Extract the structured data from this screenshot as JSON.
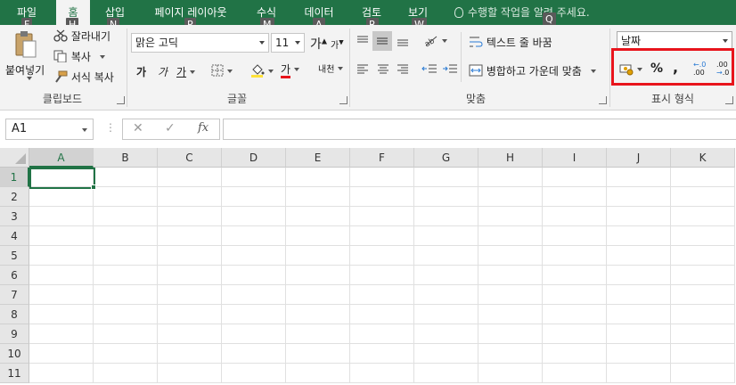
{
  "menu": {
    "tabs": [
      {
        "label": "파일",
        "key": "F"
      },
      {
        "label": "홈",
        "key": "H"
      },
      {
        "label": "삽입",
        "key": "N"
      },
      {
        "label": "페이지 레이아웃",
        "key": "P"
      },
      {
        "label": "수식",
        "key": "M"
      },
      {
        "label": "데이터",
        "key": "A"
      },
      {
        "label": "검토",
        "key": "R"
      },
      {
        "label": "보기",
        "key": "W"
      }
    ],
    "tellme": "수행할 작업을 알려 주세요.",
    "tellme_key": "Q"
  },
  "ribbon": {
    "clipboard": {
      "label": "클립보드",
      "paste": "붙여넣기",
      "cut": "잘라내기",
      "copy": "복사",
      "format_painter": "서식 복사"
    },
    "font": {
      "label": "글꼴",
      "font_name": "맑은 고딕",
      "font_size": "11",
      "grow": "가",
      "shrink": "가",
      "bold": "가",
      "italic": "가",
      "underline": "가",
      "font_color_glyph": "가",
      "phonetic": "내천",
      "font_color": "#e8141c"
    },
    "alignment": {
      "label": "맞춤",
      "wrap_text": "텍스트 줄 바꿈",
      "merge_center": "병합하고 가운데 맞춤"
    },
    "number": {
      "label": "표시 형식",
      "format": "날짜",
      "percent": "%",
      "comma": ",",
      "inc_decimal": ".00",
      "dec_decimal": ".0"
    },
    "highlight_color": "#e8141c"
  },
  "formula_bar": {
    "name_box": "A1",
    "cancel": "✕",
    "enter": "✓",
    "fx": "fx",
    "value": ""
  },
  "sheet": {
    "columns": [
      "A",
      "B",
      "C",
      "D",
      "E",
      "F",
      "G",
      "H",
      "I",
      "J",
      "K"
    ],
    "rows": [
      "1",
      "2",
      "3",
      "4",
      "5",
      "6",
      "7",
      "8",
      "9",
      "10",
      "11"
    ],
    "accent": "#217346"
  }
}
